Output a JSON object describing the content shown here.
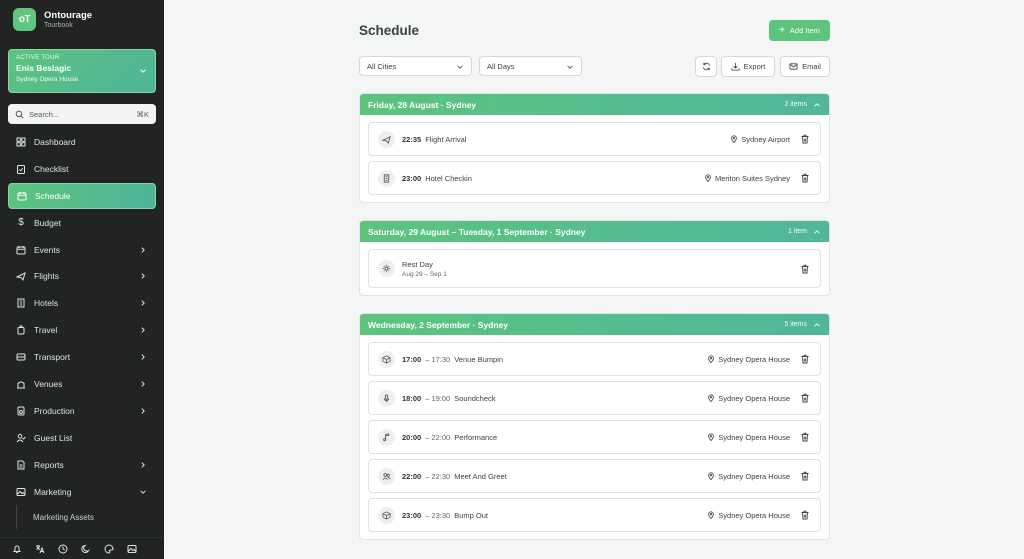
{
  "app": {
    "name": "Ontourage",
    "subtitle": "Tourbook",
    "logo_text": "oT"
  },
  "active_tour": {
    "label": "ACTIVE TOUR",
    "name": "Enis Beslagic",
    "venue": "Sydney Opera House"
  },
  "search": {
    "placeholder": "Search...",
    "shortcut": "⌘K"
  },
  "nav": {
    "items": [
      {
        "label": "Dashboard",
        "icon": "grid-icon"
      },
      {
        "label": "Checklist",
        "icon": "clipboard-check-icon"
      },
      {
        "label": "Schedule",
        "icon": "calendar-icon",
        "active": true
      },
      {
        "label": "Budget",
        "icon": "dollar-icon"
      },
      {
        "label": "Events",
        "icon": "calendar-event-icon"
      },
      {
        "label": "Flights",
        "icon": "plane-icon"
      },
      {
        "label": "Hotels",
        "icon": "building-icon"
      },
      {
        "label": "Travel",
        "icon": "luggage-icon"
      },
      {
        "label": "Transport",
        "icon": "bus-icon"
      },
      {
        "label": "Venues",
        "icon": "venue-icon"
      },
      {
        "label": "Production",
        "icon": "speaker-icon"
      },
      {
        "label": "Guest List",
        "icon": "user-check-icon"
      },
      {
        "label": "Reports",
        "icon": "report-icon"
      },
      {
        "label": "Marketing",
        "icon": "image-icon"
      }
    ],
    "sub_item": "Marketing Assets"
  },
  "footer_icons": [
    "bell-icon",
    "translate-icon",
    "clock-icon",
    "moon-icon",
    "palette-icon",
    "gallery-icon"
  ],
  "page": {
    "title": "Schedule",
    "add_button": "Add Item",
    "filters": {
      "city": "All Cities",
      "day": "All Days"
    },
    "toolbar": {
      "export": "Export",
      "email": "Email"
    }
  },
  "groups": [
    {
      "title": "Friday, 28 August · Sydney",
      "count": "2 items",
      "items": [
        {
          "icon": "plane-icon",
          "time": "22:35",
          "end": "",
          "name": "Flight Arrival",
          "location": "Sydney Airport"
        },
        {
          "icon": "building-icon",
          "time": "23:00",
          "end": "",
          "name": "Hotel Checkin",
          "location": "Meriton Suites Sydney"
        }
      ]
    },
    {
      "title": "Saturday, 29 August – Tuesday, 1 September · Sydney",
      "count": "1 item",
      "items": [
        {
          "icon": "sun-icon",
          "name": "Rest Day",
          "sub": "Aug 29 – Sep 1"
        }
      ]
    },
    {
      "title": "Wednesday, 2 September · Sydney",
      "count": "5 items",
      "items": [
        {
          "icon": "box-icon",
          "time": "17:00",
          "end": "– 17:30",
          "name": "Venue Bumpin",
          "location": "Sydney Opera House"
        },
        {
          "icon": "mic-icon",
          "time": "18:00",
          "end": "– 19:00",
          "name": "Soundcheck",
          "location": "Sydney Opera House"
        },
        {
          "icon": "music-icon",
          "time": "20:00",
          "end": "– 22:00",
          "name": "Performance",
          "location": "Sydney Opera House"
        },
        {
          "icon": "users-icon",
          "time": "22:00",
          "end": "– 22:30",
          "name": "Meet And Greet",
          "location": "Sydney Opera House"
        },
        {
          "icon": "box-icon",
          "time": "23:00",
          "end": "– 23:30",
          "name": "Bump Out",
          "location": "Sydney Opera House"
        }
      ]
    }
  ],
  "colors": {
    "accent": "#5cc47d",
    "sidebar_bg": "#222424",
    "page_bg": "#f4f5f5"
  }
}
